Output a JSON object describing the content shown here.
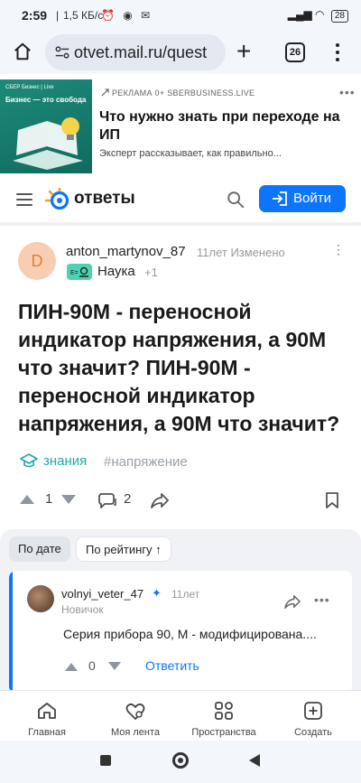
{
  "status_bar": {
    "time": "2:59",
    "speed": "1,5 КБ/с",
    "battery": "28"
  },
  "browser": {
    "url": "otvet.mail.ru/quest",
    "tab_count": "26"
  },
  "ad": {
    "image_brand": "СБЕР Бизнес | Live",
    "image_tagline": "Бизнес — это свобода",
    "meta": "РЕКЛАМА 0+ SBERBUSINESS.LIVE",
    "title": "Что нужно знать при переходе на ИП",
    "description": "Эксперт рассказывает, как правильно..."
  },
  "site_header": {
    "logo": "ответы",
    "login_label": "Войти"
  },
  "question": {
    "avatar_letter": "D",
    "author": "anton_martynov_87",
    "meta": "11лет Изменено",
    "category": "Наука",
    "category_extra": "+1",
    "title": "ПИН-90М - переносной индикатор напряжения, а 90М что значит? ПИН-90М - переносной индикатор напряжения, а 90М что значит?",
    "tags": [
      "знания",
      "#напряжение"
    ],
    "votes": "1",
    "comments": "2"
  },
  "sorting": {
    "by_date": "По дате",
    "by_rating": "По рейтингу ↑"
  },
  "answer": {
    "author": "volnyi_veter_47",
    "pin": "✦",
    "time": "11лет",
    "rank": "Новичок",
    "text": "Серия прибора 90, М - модифицирована....",
    "votes": "0",
    "reply_label": "Ответить"
  },
  "bottom_nav": [
    {
      "label": "Главная",
      "icon": "home-icon"
    },
    {
      "label": "Моя лента",
      "icon": "heart-icon"
    },
    {
      "label": "Пространства",
      "icon": "grid-icon"
    },
    {
      "label": "Создать",
      "icon": "plus-square-icon"
    }
  ],
  "colors": {
    "accent": "#0d75fb",
    "tag": "#1fa8a3",
    "avatar_bg": "#f7ceb1"
  }
}
